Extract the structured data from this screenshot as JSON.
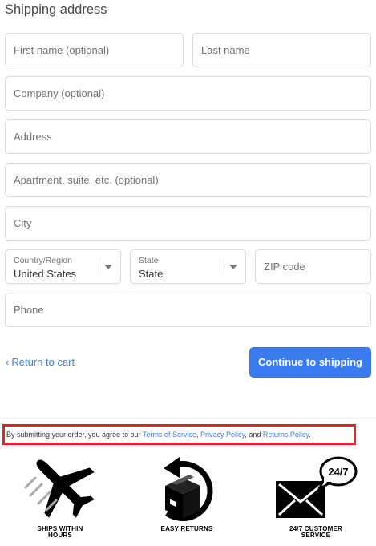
{
  "section_title": "Shipping address",
  "form": {
    "first_name_placeholder": "First name (optional)",
    "last_name_placeholder": "Last name",
    "company_placeholder": "Company (optional)",
    "address_placeholder": "Address",
    "apartment_placeholder": "Apartment, suite, etc. (optional)",
    "city_placeholder": "City",
    "country": {
      "label": "Country/Region",
      "value": "United States"
    },
    "state": {
      "label": "State",
      "value": "State"
    },
    "zip_placeholder": "ZIP code",
    "phone_placeholder": "Phone"
  },
  "nav": {
    "back_label": "Return to cart",
    "continue_label": "Continue to shipping"
  },
  "notice": {
    "prefix": "By submitting your order, you agree to our ",
    "terms": "Terms of Service",
    "sep1": ", ",
    "privacy": "Privacy Policy",
    "sep2": ", and ",
    "returns": "Returns Policy",
    "suffix": "."
  },
  "features": [
    {
      "icon": "airplane-icon",
      "line1": "SHIPS WITHIN",
      "line2": "HOURS"
    },
    {
      "icon": "return-box-icon",
      "line1": "EASY RETURNS",
      "line2": ""
    },
    {
      "icon": "envelope-24-7-icon",
      "line1": "24/7 CUSTOMER",
      "line2": "SERVICE",
      "badge": "24/7"
    }
  ],
  "colors": {
    "accent": "#3a7cf0",
    "link": "#3f7fd6",
    "highlight_border": "#e0242d"
  }
}
